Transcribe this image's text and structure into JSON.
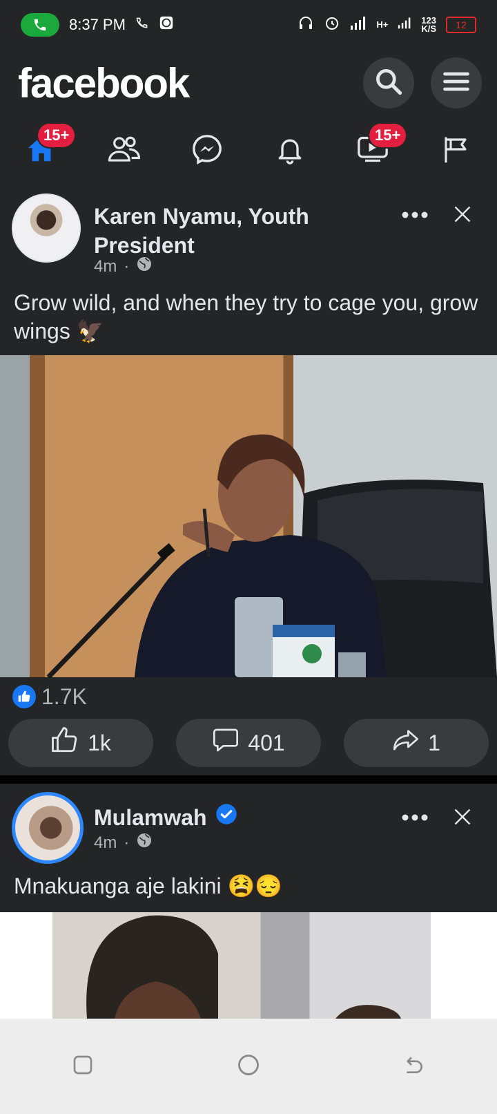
{
  "status_bar": {
    "time": "8:37 PM",
    "network": "H+",
    "speed_top": "123",
    "speed_bottom": "K/S",
    "battery": "12"
  },
  "header": {
    "logo": "facebook",
    "search_icon": "search-icon",
    "menu_icon": "menu-icon"
  },
  "nav": {
    "items": [
      {
        "name": "home",
        "badge": "15+"
      },
      {
        "name": "friends"
      },
      {
        "name": "messenger"
      },
      {
        "name": "notifications"
      },
      {
        "name": "video",
        "badge": "15+"
      },
      {
        "name": "pages"
      }
    ]
  },
  "posts": [
    {
      "author": "Karen Nyamu, Youth President",
      "time": "4m",
      "text": "Grow wild, and when they try to cage you, grow wings 🦅",
      "reactions_count": "1.7K",
      "likes": "1k",
      "comments": "401",
      "shares": "1"
    },
    {
      "author": "Mulamwah",
      "time": "4m",
      "text": "Mnakuanga aje lakini 😫😔"
    }
  ],
  "colors": {
    "background": "#242526",
    "accent": "#1877f2",
    "badge": "#e41e3f"
  }
}
